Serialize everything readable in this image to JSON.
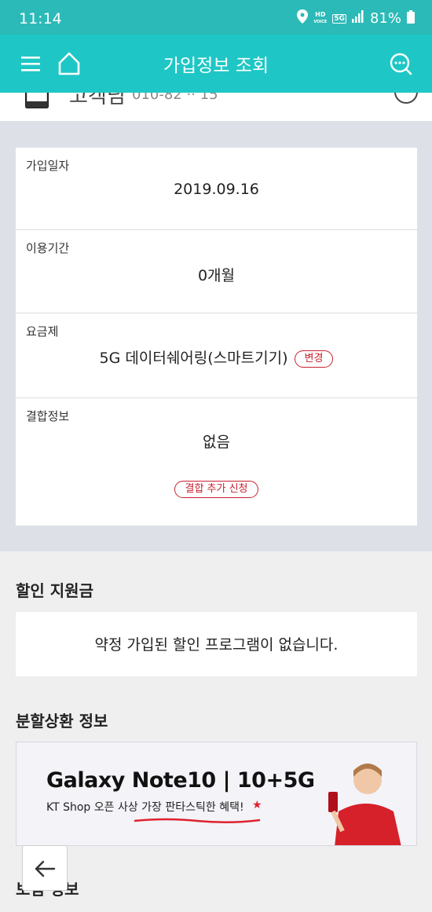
{
  "status_bar": {
    "time": "11:14",
    "hd_label": "HD",
    "voice_label": "VOICE",
    "net_label": "5G",
    "battery": "81%"
  },
  "header": {
    "title": "가입정보 조회",
    "menu_icon": "hamburger-menu-icon",
    "home_icon": "home-icon",
    "chat_icon": "chat-search-icon"
  },
  "peek": {
    "name": "고객님",
    "phone": "010-82 ·· 15"
  },
  "info": {
    "join_date": {
      "label": "가입일자",
      "value": "2019.09.16"
    },
    "usage_period": {
      "label": "이용기간",
      "value": "0개월"
    },
    "plan": {
      "label": "요금제",
      "value": "5G 데이터쉐어링(스마트기기)",
      "change_label": "변경"
    },
    "bundle": {
      "label": "결합정보",
      "value": "없음",
      "apply_label": "결합 추가 신청"
    }
  },
  "discount": {
    "title": "할인 지원금",
    "empty_text": "약정 가입된 할인 프로그램이 없습니다."
  },
  "installment": {
    "title": "분할상환 정보",
    "banner": {
      "headline": "Galaxy Note10 | 10+5G",
      "subline": "KT Shop 오픈 사상 가장 판타스틱한 혜택!"
    }
  },
  "insurance": {
    "title": "보험 정보"
  },
  "colors": {
    "status_bar": "#2bbab7",
    "header": "#1ec7c5",
    "accent_red": "#c8202f"
  }
}
